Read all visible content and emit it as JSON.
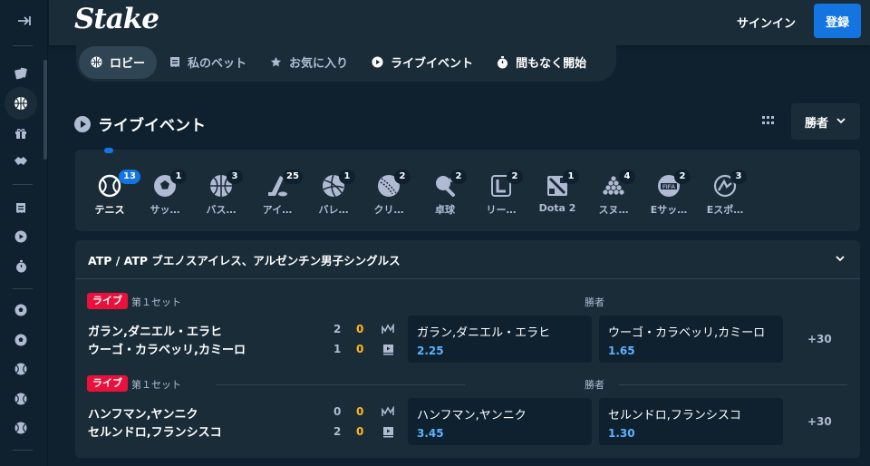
{
  "header": {
    "logo": "Stake",
    "signin": "サインイン",
    "register": "登録"
  },
  "tabs": [
    {
      "label": "ロビー",
      "icon": "basketball-icon"
    },
    {
      "label": "私のベット",
      "icon": "receipt-icon"
    },
    {
      "label": "お気に入り",
      "icon": "star-icon"
    },
    {
      "label": "ライブイベント",
      "icon": "play-icon"
    },
    {
      "label": "間もなく開始",
      "icon": "stopwatch-icon"
    }
  ],
  "section": {
    "title": "ライブイベント",
    "dropdown": "勝者"
  },
  "sports": [
    {
      "label": "テニス",
      "count": "13",
      "icon": "tennis-icon"
    },
    {
      "label": "サッ…",
      "count": "1",
      "icon": "soccer-icon"
    },
    {
      "label": "バス…",
      "count": "3",
      "icon": "basketball-icon"
    },
    {
      "label": "アイ…",
      "count": "25",
      "icon": "ice-hockey-icon"
    },
    {
      "label": "バレ…",
      "count": "1",
      "icon": "volleyball-icon"
    },
    {
      "label": "クリ…",
      "count": "2",
      "icon": "cricket-icon"
    },
    {
      "label": "卓球",
      "count": "2",
      "icon": "table-tennis-icon"
    },
    {
      "label": "リー…",
      "count": "2",
      "icon": "league-icon"
    },
    {
      "label": "Dota 2",
      "count": "1",
      "icon": "dota-icon"
    },
    {
      "label": "スヌ…",
      "count": "4",
      "icon": "snooker-icon"
    },
    {
      "label": "Eサッ…",
      "count": "2",
      "icon": "fifa-icon"
    },
    {
      "label": "Eスポ…",
      "count": "3",
      "icon": "esports-icon"
    }
  ],
  "tournament": "ATP / ATP ブエノスアイレス、アルゼンチン男子シングルス",
  "matches": [
    {
      "live": "ライブ",
      "set": "第１セット",
      "market": "勝者",
      "p1": "ガラン,ダニエル・エラヒ",
      "p2": "ウーゴ・カラベッリ,カミーロ",
      "p1_sets": "2",
      "p1_games": "0",
      "p2_sets": "1",
      "p2_games": "0",
      "odd1_name": "ガラン,ダニエル・エラヒ",
      "odd1_value": "2.25",
      "odd2_name": "ウーゴ・カラベッリ,カミーロ",
      "odd2_value": "1.65",
      "more": "+30"
    },
    {
      "live": "ライブ",
      "set": "第１セット",
      "market": "勝者",
      "p1": "ハンフマン,ヤンニク",
      "p2": "セルンドロ,フランシスコ",
      "p1_sets": "0",
      "p1_games": "0",
      "p2_sets": "2",
      "p2_games": "0",
      "odd1_name": "ハンフマン,ヤンニク",
      "odd1_value": "3.45",
      "odd2_name": "セルンドロ,フランシスコ",
      "odd2_value": "1.30",
      "more": "+30"
    }
  ],
  "colors": {
    "background": "#0f212e",
    "surface": "#1a2c38",
    "accent": "#1475e1",
    "live": "#e9113c",
    "odds": "#5db1ff",
    "score_highlight": "#ffb71a"
  }
}
